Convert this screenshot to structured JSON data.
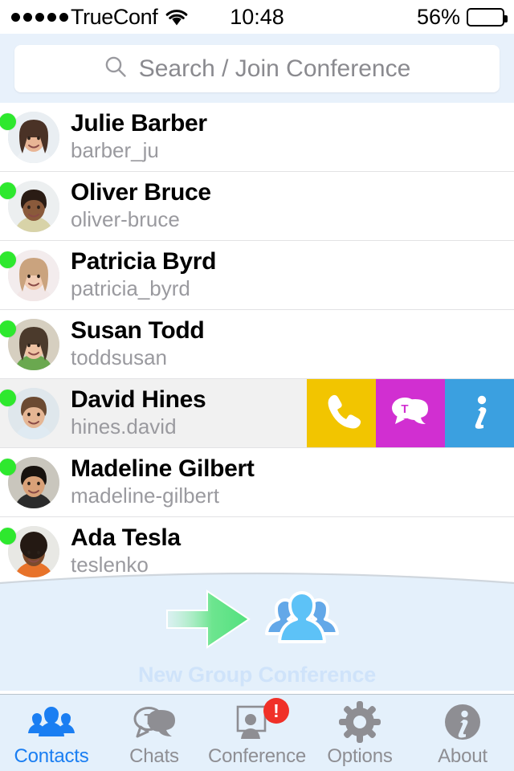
{
  "status_bar": {
    "signal_dots": 5,
    "carrier": "TrueConf",
    "wifi_icon": "wifi-icon",
    "time": "10:48",
    "battery_percent": "56%",
    "battery_level": 56
  },
  "search": {
    "icon": "search-icon",
    "placeholder": "Search / Join Conference",
    "value": ""
  },
  "contacts": [
    {
      "name": "Julie Barber",
      "login": "barber_ju",
      "status": "online",
      "selected": false
    },
    {
      "name": "Oliver Bruce",
      "login": "oliver-bruce",
      "status": "online",
      "selected": false
    },
    {
      "name": "Patricia Byrd",
      "login": "patricia_byrd",
      "status": "online",
      "selected": false
    },
    {
      "name": "Susan Todd",
      "login": "toddsusan",
      "status": "online",
      "selected": false
    },
    {
      "name": "David Hines",
      "login": "hines.david",
      "status": "online",
      "selected": true
    },
    {
      "name": "Madeline Gilbert",
      "login": "madeline-gilbert",
      "status": "online",
      "selected": false
    },
    {
      "name": "Ada Tesla",
      "login": "teslenko",
      "status": "online",
      "selected": false
    }
  ],
  "swipe_actions": {
    "visible_on_contact": "David Hines",
    "buttons": [
      {
        "name": "call",
        "icon": "phone-icon",
        "color": "#F2C500"
      },
      {
        "name": "chat",
        "icon": "chat-bubble-icon",
        "color": "#D12FD1"
      },
      {
        "name": "info",
        "icon": "info-icon",
        "color": "#3BA0E0"
      }
    ]
  },
  "new_group_conference": {
    "label": "New Group Conference",
    "arrow_icon": "green-arrow-icon",
    "group_icon": "group-people-icon"
  },
  "tab_bar": {
    "items": [
      {
        "label": "Contacts",
        "icon": "contacts-group-icon",
        "active": true,
        "badge": ""
      },
      {
        "label": "Chats",
        "icon": "chat-bubble-t-icon",
        "active": false,
        "badge": ""
      },
      {
        "label": "Conference",
        "icon": "conference-icon",
        "active": false,
        "badge": "!"
      },
      {
        "label": "Options",
        "icon": "gear-icon",
        "active": false,
        "badge": ""
      },
      {
        "label": "About",
        "icon": "info-circle-icon",
        "active": false,
        "badge": ""
      }
    ]
  },
  "colors": {
    "accent": "#1a7ef2",
    "online": "#2ee82e",
    "badge": "#f03028",
    "panel_bg": "#e4f0fb"
  }
}
